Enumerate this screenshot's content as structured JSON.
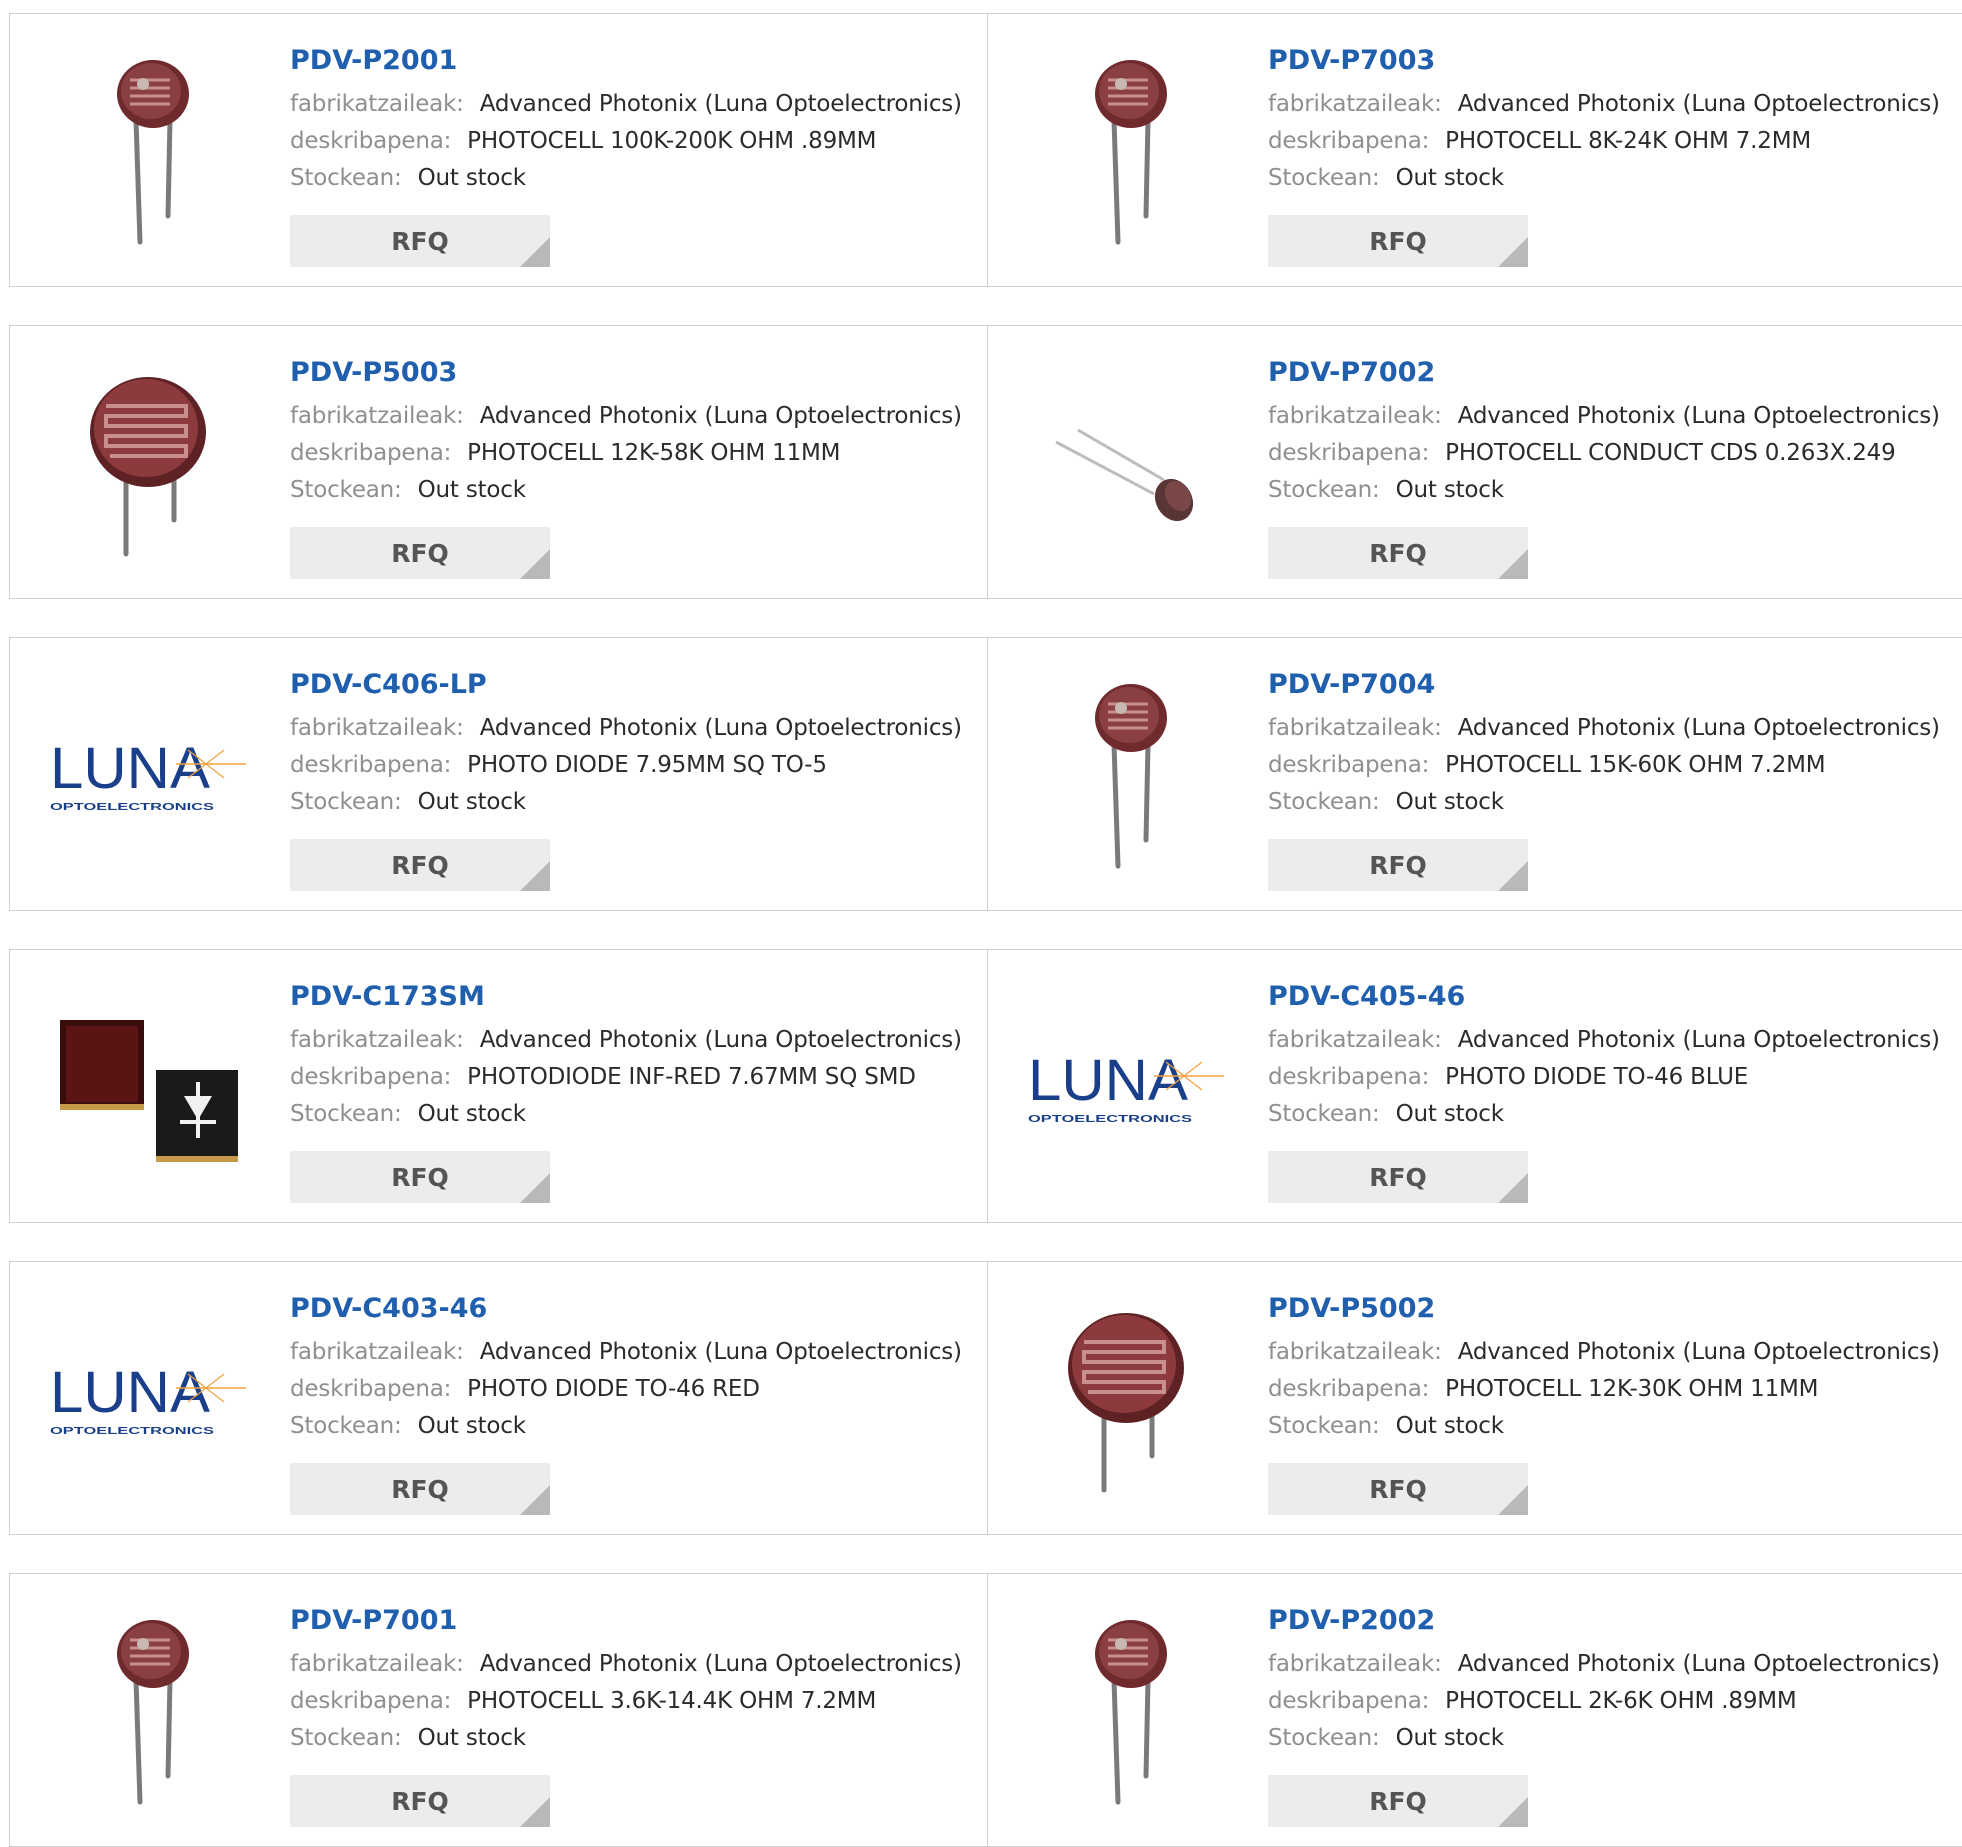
{
  "labels": {
    "manufacturer": "fabrikatzaileak:",
    "description": "deskribapena:",
    "stock": "Stockean:",
    "rfq": "RFQ"
  },
  "logo": {
    "word": "LUNA",
    "sub": "OPTOELECTRONICS"
  },
  "colors": {
    "title": "#1f5fae",
    "label": "#8f8f8f",
    "value": "#2b2b2b",
    "rfq_bg": "#ececec",
    "rfq_corner": "#b9b9b9"
  },
  "products": [
    {
      "part": "PDV-P2001",
      "manufacturer": "Advanced Photonix (Luna Optoelectronics)",
      "description": "PHOTOCELL 100K-200K OHM .89MM",
      "stock": "Out stock",
      "image": "photocell-small"
    },
    {
      "part": "PDV-P7003",
      "manufacturer": "Advanced Photonix (Luna Optoelectronics)",
      "description": "PHOTOCELL 8K-24K OHM 7.2MM",
      "stock": "Out stock",
      "image": "photocell-small"
    },
    {
      "part": "PDV-P5003",
      "manufacturer": "Advanced Photonix (Luna Optoelectronics)",
      "description": "PHOTOCELL 12K-58K OHM 11MM",
      "stock": "Out stock",
      "image": "photocell-large"
    },
    {
      "part": "PDV-P7002",
      "manufacturer": "Advanced Photonix (Luna Optoelectronics)",
      "description": "PHOTOCELL CONDUCT CDS 0.263X.249",
      "stock": "Out stock",
      "image": "photocell-side"
    },
    {
      "part": "PDV-C406-LP",
      "manufacturer": "Advanced Photonix (Luna Optoelectronics)",
      "description": "PHOTO DIODE 7.95MM SQ TO-5",
      "stock": "Out stock",
      "image": "luna-logo"
    },
    {
      "part": "PDV-P7004",
      "manufacturer": "Advanced Photonix (Luna Optoelectronics)",
      "description": "PHOTOCELL 15K-60K OHM 7.2MM",
      "stock": "Out stock",
      "image": "photocell-small"
    },
    {
      "part": "PDV-C173SM",
      "manufacturer": "Advanced Photonix (Luna Optoelectronics)",
      "description": "PHOTODIODE INF-RED 7.67MM SQ SMD",
      "stock": "Out stock",
      "image": "smd-photodiode"
    },
    {
      "part": "PDV-C405-46",
      "manufacturer": "Advanced Photonix (Luna Optoelectronics)",
      "description": "PHOTO DIODE TO-46 BLUE",
      "stock": "Out stock",
      "image": "luna-logo"
    },
    {
      "part": "PDV-C403-46",
      "manufacturer": "Advanced Photonix (Luna Optoelectronics)",
      "description": "PHOTO DIODE TO-46 RED",
      "stock": "Out stock",
      "image": "luna-logo"
    },
    {
      "part": "PDV-P5002",
      "manufacturer": "Advanced Photonix (Luna Optoelectronics)",
      "description": "PHOTOCELL 12K-30K OHM 11MM",
      "stock": "Out stock",
      "image": "photocell-large"
    },
    {
      "part": "PDV-P7001",
      "manufacturer": "Advanced Photonix (Luna Optoelectronics)",
      "description": "PHOTOCELL 3.6K-14.4K OHM 7.2MM",
      "stock": "Out stock",
      "image": "photocell-small"
    },
    {
      "part": "PDV-P2002",
      "manufacturer": "Advanced Photonix (Luna Optoelectronics)",
      "description": "PHOTOCELL 2K-6K OHM .89MM",
      "stock": "Out stock",
      "image": "photocell-small"
    }
  ]
}
